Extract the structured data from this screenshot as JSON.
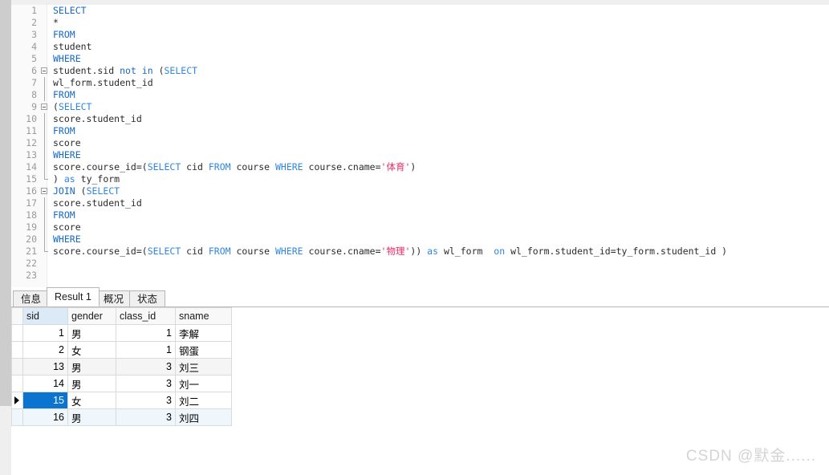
{
  "editor": {
    "lines": [
      {
        "n": "1",
        "fold": "none",
        "tokens": [
          {
            "t": "SELECT",
            "c": "kw"
          }
        ]
      },
      {
        "n": "2",
        "fold": "none",
        "tokens": [
          {
            "t": "*",
            "c": "pl"
          }
        ]
      },
      {
        "n": "3",
        "fold": "none",
        "tokens": [
          {
            "t": "FROM",
            "c": "kw"
          }
        ]
      },
      {
        "n": "4",
        "fold": "none",
        "tokens": [
          {
            "t": "student",
            "c": "pl"
          }
        ]
      },
      {
        "n": "5",
        "fold": "none",
        "tokens": [
          {
            "t": "WHERE",
            "c": "kw"
          }
        ]
      },
      {
        "n": "6",
        "fold": "box",
        "tokens": [
          {
            "t": "student.sid ",
            "c": "pl"
          },
          {
            "t": "not in",
            "c": "kw"
          },
          {
            "t": " (",
            "c": "pl"
          },
          {
            "t": "SELECT",
            "c": "kw2"
          }
        ]
      },
      {
        "n": "7",
        "fold": "line",
        "tokens": [
          {
            "t": "wl_form.student_id",
            "c": "pl"
          }
        ]
      },
      {
        "n": "8",
        "fold": "line",
        "tokens": [
          {
            "t": "FROM",
            "c": "kw"
          }
        ]
      },
      {
        "n": "9",
        "fold": "box-line",
        "tokens": [
          {
            "t": "(",
            "c": "pl"
          },
          {
            "t": "SELECT",
            "c": "kw2"
          }
        ]
      },
      {
        "n": "10",
        "fold": "line",
        "tokens": [
          {
            "t": "score.student_id",
            "c": "pl"
          }
        ]
      },
      {
        "n": "11",
        "fold": "line",
        "tokens": [
          {
            "t": "FROM",
            "c": "kw"
          }
        ]
      },
      {
        "n": "12",
        "fold": "line",
        "tokens": [
          {
            "t": "score",
            "c": "pl"
          }
        ]
      },
      {
        "n": "13",
        "fold": "line",
        "tokens": [
          {
            "t": "WHERE",
            "c": "kw"
          }
        ]
      },
      {
        "n": "14",
        "fold": "line",
        "tokens": [
          {
            "t": "score.course_id=(",
            "c": "pl"
          },
          {
            "t": "SELECT",
            "c": "kw2"
          },
          {
            "t": " cid ",
            "c": "pl"
          },
          {
            "t": "FROM",
            "c": "kw2"
          },
          {
            "t": " course ",
            "c": "pl"
          },
          {
            "t": "WHERE",
            "c": "kw2"
          },
          {
            "t": " course.cname=",
            "c": "pl"
          },
          {
            "t": "'体育'",
            "c": "str"
          },
          {
            "t": ")",
            "c": "pl"
          }
        ]
      },
      {
        "n": "15",
        "fold": "end",
        "tokens": [
          {
            "t": ") ",
            "c": "pl"
          },
          {
            "t": "as",
            "c": "kw2"
          },
          {
            "t": " ty_form",
            "c": "pl"
          }
        ]
      },
      {
        "n": "16",
        "fold": "box",
        "tokens": [
          {
            "t": "JOIN",
            "c": "kw"
          },
          {
            "t": " (",
            "c": "pl"
          },
          {
            "t": "SELECT",
            "c": "kw2"
          }
        ]
      },
      {
        "n": "17",
        "fold": "line",
        "tokens": [
          {
            "t": "score.student_id",
            "c": "pl"
          }
        ]
      },
      {
        "n": "18",
        "fold": "line",
        "tokens": [
          {
            "t": "FROM",
            "c": "kw"
          }
        ]
      },
      {
        "n": "19",
        "fold": "line",
        "tokens": [
          {
            "t": "score",
            "c": "pl"
          }
        ]
      },
      {
        "n": "20",
        "fold": "line",
        "tokens": [
          {
            "t": "WHERE",
            "c": "kw"
          }
        ]
      },
      {
        "n": "21",
        "fold": "end",
        "tokens": [
          {
            "t": "score.course_id=(",
            "c": "pl"
          },
          {
            "t": "SELECT",
            "c": "kw2"
          },
          {
            "t": " cid ",
            "c": "pl"
          },
          {
            "t": "FROM",
            "c": "kw2"
          },
          {
            "t": " course ",
            "c": "pl"
          },
          {
            "t": "WHERE",
            "c": "kw2"
          },
          {
            "t": " course.cname=",
            "c": "pl"
          },
          {
            "t": "'物理'",
            "c": "str"
          },
          {
            "t": ")) ",
            "c": "pl"
          },
          {
            "t": "as",
            "c": "kw2"
          },
          {
            "t": " wl_form  ",
            "c": "pl"
          },
          {
            "t": "on",
            "c": "kw2"
          },
          {
            "t": " wl_form.student_id=ty_form.student_id )",
            "c": "pl"
          }
        ]
      },
      {
        "n": "22",
        "fold": "none",
        "tokens": []
      },
      {
        "n": "23",
        "fold": "none",
        "tokens": []
      }
    ]
  },
  "results": {
    "tabs": [
      {
        "label": "信息",
        "active": false
      },
      {
        "label": "Result 1",
        "active": true
      },
      {
        "label": "概况",
        "active": false
      },
      {
        "label": "状态",
        "active": false
      }
    ],
    "columns": [
      "sid",
      "gender",
      "class_id",
      "sname"
    ],
    "selected_column": "sid",
    "selected_row_index": 4,
    "rows": [
      {
        "sid": "1",
        "gender": "男",
        "class_id": "1",
        "sname": "李解"
      },
      {
        "sid": "2",
        "gender": "女",
        "class_id": "1",
        "sname": "钢蛋"
      },
      {
        "sid": "13",
        "gender": "男",
        "class_id": "3",
        "sname": "刘三"
      },
      {
        "sid": "14",
        "gender": "男",
        "class_id": "3",
        "sname": "刘一"
      },
      {
        "sid": "15",
        "gender": "女",
        "class_id": "3",
        "sname": "刘二"
      },
      {
        "sid": "16",
        "gender": "男",
        "class_id": "3",
        "sname": "刘四"
      }
    ]
  },
  "watermark": {
    "text": "CSDN @默金......"
  },
  "colors": {
    "keyword": "#1569c7",
    "string": "#ec2c64",
    "selection": "#0a74d0",
    "column_header_selected": "#dceaf7"
  }
}
